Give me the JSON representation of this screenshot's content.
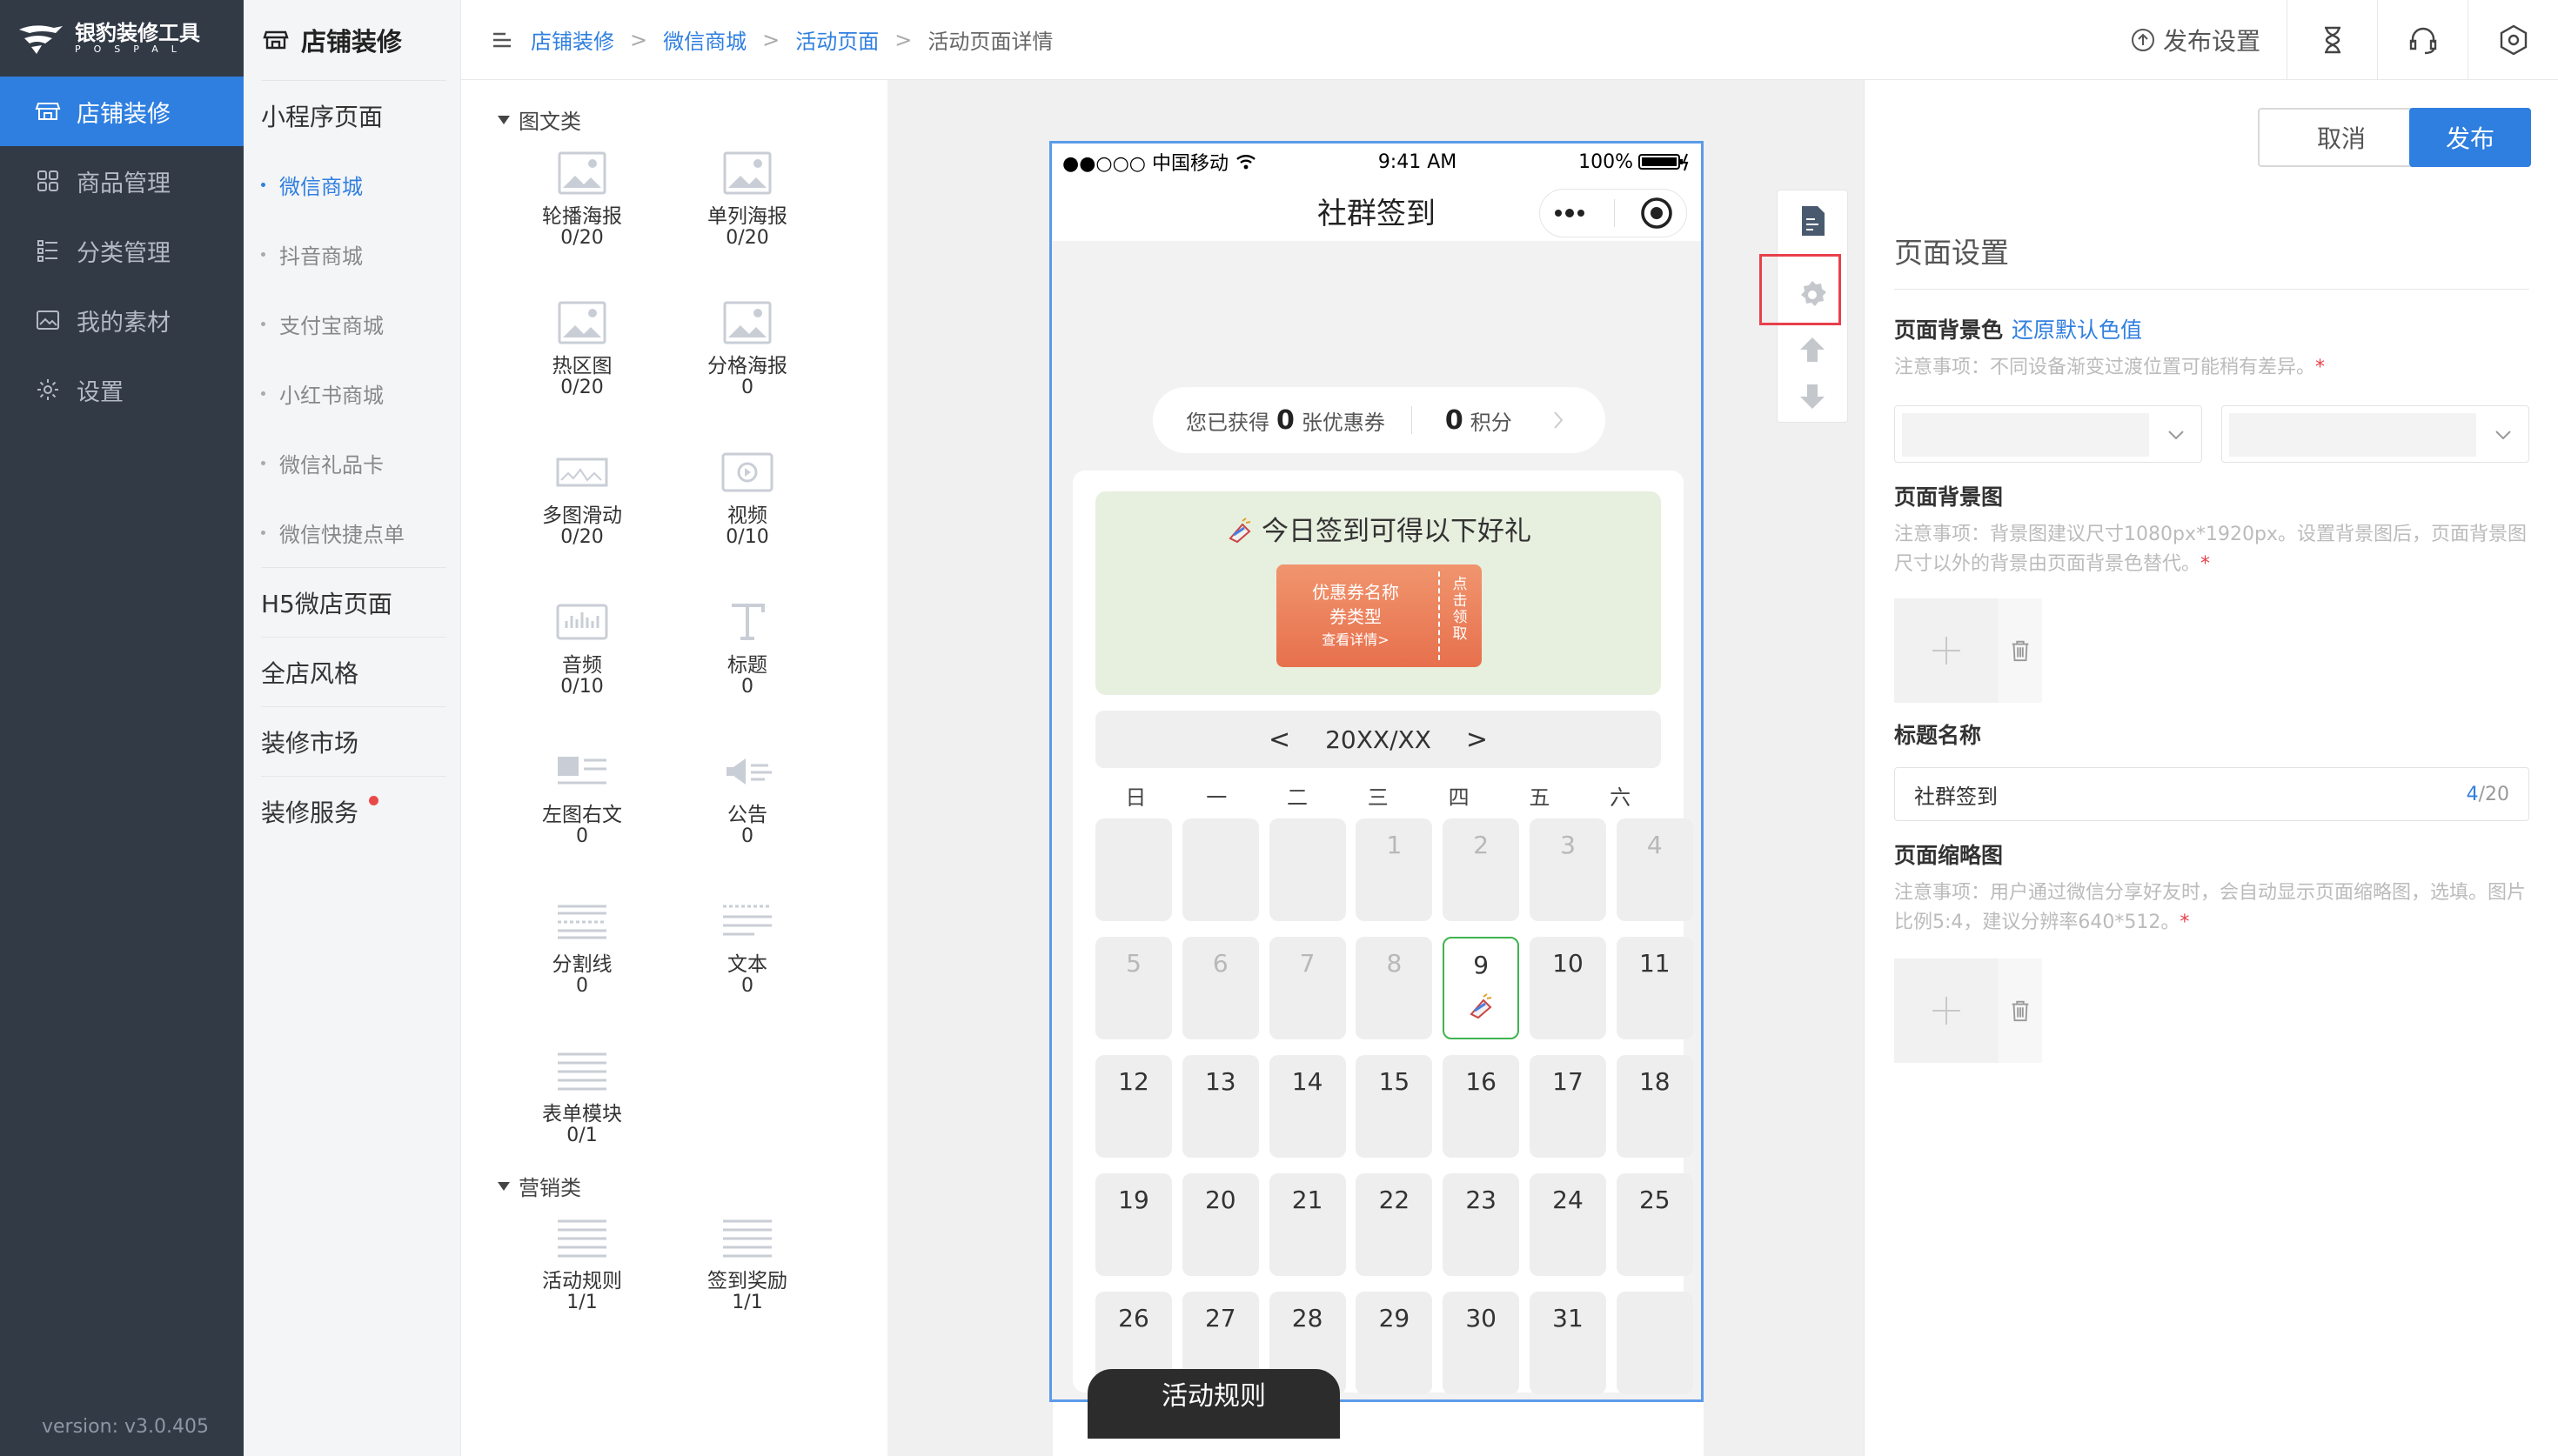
{
  "app": {
    "logo_title": "银豹装修工具",
    "logo_sub": "POSPAL",
    "version": "version: v3.0.405"
  },
  "nav": {
    "items": [
      {
        "label": "店铺装修",
        "icon": "store-icon",
        "active": true
      },
      {
        "label": "商品管理",
        "icon": "grid-icon"
      },
      {
        "label": "分类管理",
        "icon": "list-icon"
      },
      {
        "label": "我的素材",
        "icon": "image-icon"
      },
      {
        "label": "设置",
        "icon": "gear-icon"
      }
    ]
  },
  "subnav": {
    "title": "店铺装修",
    "mini_program": "小程序页面",
    "mini_items": [
      "微信商城",
      "抖音商城",
      "支付宝商城",
      "小红书商城",
      "微信礼品卡",
      "微信快捷点单"
    ],
    "h5": "H5微店页面",
    "style": "全店风格",
    "market": "装修市场",
    "service": "装修服务"
  },
  "breadcrumb": [
    "店铺装修",
    "微信商城",
    "活动页面",
    "活动页面详情"
  ],
  "topbar": {
    "publish_setting": "发布设置"
  },
  "palette": {
    "section1": "图文类",
    "section2": "营销类",
    "components": [
      {
        "name": "轮播海报",
        "count": "0/20"
      },
      {
        "name": "单列海报",
        "count": "0/20"
      },
      {
        "name": "热区图",
        "count": "0/20"
      },
      {
        "name": "分格海报",
        "count": "0"
      },
      {
        "name": "多图滑动",
        "count": "0/20"
      },
      {
        "name": "视频",
        "count": "0/10"
      },
      {
        "name": "音频",
        "count": "0/10"
      },
      {
        "name": "标题",
        "count": "0"
      },
      {
        "name": "左图右文",
        "count": "0"
      },
      {
        "name": "公告",
        "count": "0"
      },
      {
        "name": "分割线",
        "count": "0"
      },
      {
        "name": "文本",
        "count": "0"
      },
      {
        "name": "表单模块",
        "count": "0/1"
      }
    ],
    "marketing": [
      {
        "name": "活动规则",
        "count": "1/1"
      },
      {
        "name": "签到奖励",
        "count": "1/1"
      }
    ]
  },
  "phone": {
    "carrier": "●●○○○ 中国移动",
    "time": "9:41 AM",
    "battery": "100%",
    "title": "社群签到",
    "stats_prefix": "您已获得",
    "coupons_value": "0",
    "coupons_label": "张优惠券",
    "points_value": "0",
    "points_label": "积分",
    "gift_title": "今日签到可得以下好礼",
    "coupon_name": "优惠券名称",
    "coupon_type": "券类型",
    "coupon_detail": "查看详情>",
    "coupon_action": "点击领取",
    "month": "20XX/XX",
    "prev": "<",
    "next": ">",
    "weekdays": [
      "日",
      "一",
      "二",
      "三",
      "四",
      "五",
      "六"
    ],
    "days": [
      "",
      "",
      "",
      "1",
      "2",
      "3",
      "4",
      "5",
      "6",
      "7",
      "8",
      "9",
      "10",
      "11",
      "12",
      "13",
      "14",
      "15",
      "16",
      "17",
      "18",
      "19",
      "20",
      "21",
      "22",
      "23",
      "24",
      "25",
      "26",
      "27",
      "28",
      "29",
      "30",
      "31",
      ""
    ],
    "past_until": 8,
    "today": "9",
    "rules_tab": "活动规则"
  },
  "panel": {
    "cancel": "取消",
    "publish": "发布",
    "title": "页面设置",
    "bg_color_label": "页面背景色",
    "bg_color_reset": "还原默认色值",
    "bg_color_hint": "注意事项：不同设备渐变过渡位置可能稍有差异。",
    "bg_image_label": "页面背景图",
    "bg_image_hint": "注意事项：背景图建议尺寸1080px*1920px。设置背景图后，页面背景图尺寸以外的背景由页面背景色替代。",
    "title_label": "标题名称",
    "title_value": "社群签到",
    "title_count": "4",
    "title_max": "/20",
    "thumb_label": "页面缩略图",
    "thumb_hint": "注意事项：用户通过微信分享好友时，会自动显示页面缩略图，选填。图片比例5:4，建议分辨率640*512。",
    "required_mark": "*"
  },
  "colors": {
    "accent": "#2f7fe0",
    "nav_bg": "#323a46",
    "highlight": "#e8404a",
    "today_border": "#3fb34f"
  }
}
